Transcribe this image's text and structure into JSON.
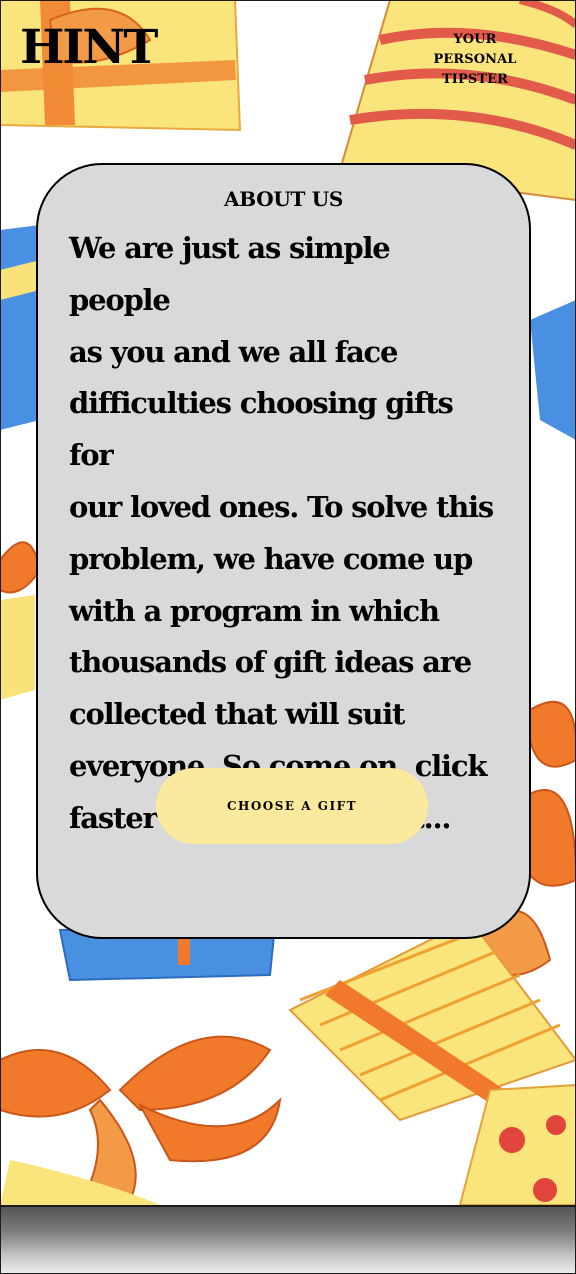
{
  "header": {
    "logo": "HINT",
    "tagline_line1": "YOUR PERSONAL",
    "tagline_line2": "TIPSTER"
  },
  "about": {
    "title": "ABOUT US",
    "lines": [
      "We are just as simple people",
      "as you and we all face",
      "difficulties choosing gifts for",
      "our loved ones. To solve this",
      "problem, we have come up",
      "with a program in which",
      "thousands of gift ideas are",
      "collected that will suit",
      "everyone. So come on, click",
      "faster and choose a gift..."
    ],
    "button_label": "CHOOSE A GIFT"
  },
  "colors": {
    "card_bg": "#d9d9d9",
    "button_bg": "#fbe99d",
    "gift_yellow": "#f9e27a",
    "gift_orange": "#f07a2a",
    "gift_blue": "#4a90e2",
    "gift_red": "#e0443a"
  },
  "icons": [
    "gift-box-icon",
    "ribbon-bow-icon"
  ]
}
